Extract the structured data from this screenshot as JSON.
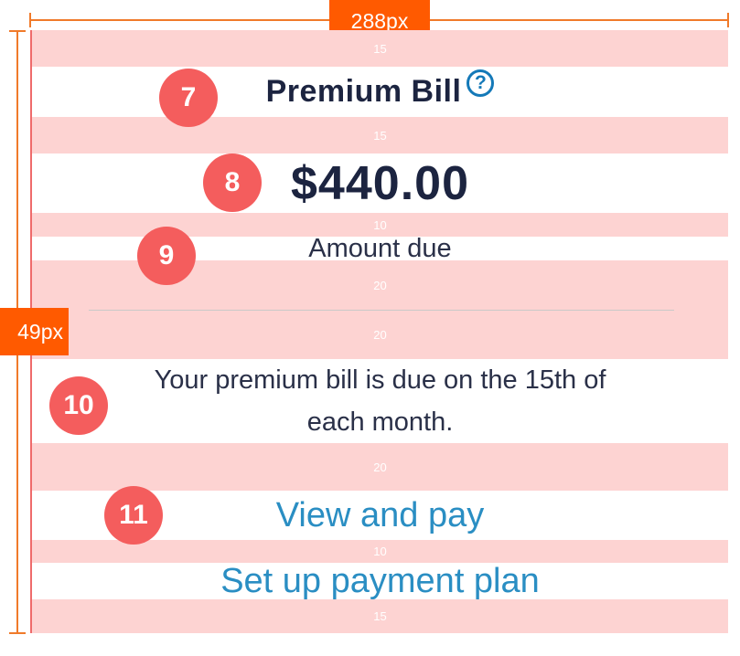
{
  "annotations": {
    "width_label": "288px",
    "height_label": "49px"
  },
  "card": {
    "title": "Premium Bill",
    "help_glyph": "?",
    "amount": "$440.00",
    "amount_label": "Amount due",
    "message": "Your premium bill is due on the 15th of each month.",
    "links": {
      "view_and_pay": "View and pay",
      "setup_plan": "Set up payment plan"
    }
  },
  "spacing": {
    "s1": "15",
    "s2": "15",
    "s3": "10",
    "s4": "20",
    "s5": "20",
    "s6": "20",
    "s7": "10",
    "s8": "15"
  },
  "markers": {
    "m7": "7",
    "m8": "8",
    "m9": "9",
    "m10": "10",
    "m11": "11"
  },
  "colors": {
    "band": "#fdd3d2",
    "marker": "#f45d5d",
    "measure": "#ff5a00",
    "link": "#2a8ec3",
    "text_dark": "#1c2440"
  }
}
